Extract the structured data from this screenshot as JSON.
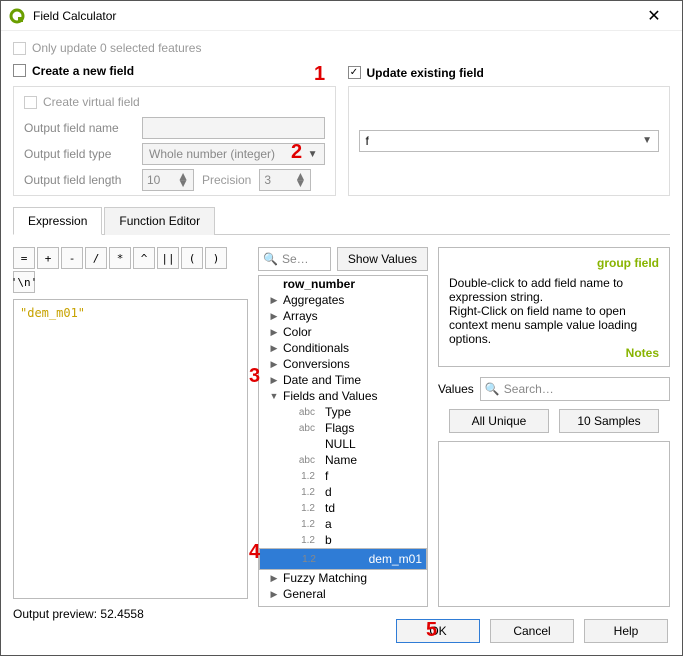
{
  "window": {
    "title": "Field Calculator"
  },
  "top": {
    "only_update_label": "Only update 0 selected features",
    "create_new_label": "Create a new field",
    "update_existing_label": "Update existing field"
  },
  "newfield": {
    "virtual_label": "Create virtual field",
    "name_label": "Output field name",
    "name_value": "",
    "type_label": "Output field type",
    "type_value": "Whole number (integer)",
    "length_label": "Output field length",
    "length_value": "10",
    "precision_label": "Precision",
    "precision_value": "3"
  },
  "updatefield": {
    "selected": "f"
  },
  "tabs": {
    "expression": "Expression",
    "function_editor": "Function Editor"
  },
  "operators": [
    "=",
    "+",
    "-",
    "/",
    "*",
    "^",
    "||",
    "(",
    ")",
    "'\\n'"
  ],
  "expression": {
    "text": "\"dem_m01\""
  },
  "preview": {
    "label": "Output preview:",
    "value": "52.4558"
  },
  "mid": {
    "search_placeholder": "Se…",
    "show_values": "Show Values",
    "tree": {
      "row_number": "row_number",
      "groups_collapsed": [
        "Aggregates",
        "Arrays",
        "Color",
        "Conditionals",
        "Conversions",
        "Date and Time"
      ],
      "expanded_group": "Fields and Values",
      "fields": [
        {
          "t": "abc",
          "n": "Type"
        },
        {
          "t": "abc",
          "n": "Flags"
        },
        {
          "t": "",
          "n": "NULL"
        },
        {
          "t": "abc",
          "n": "Name"
        },
        {
          "t": "1.2",
          "n": "f"
        },
        {
          "t": "1.2",
          "n": "d"
        },
        {
          "t": "1.2",
          "n": "td"
        },
        {
          "t": "1.2",
          "n": "a"
        },
        {
          "t": "1.2",
          "n": "b"
        },
        {
          "t": "1.2",
          "n": "dem_m01"
        }
      ],
      "groups_after": [
        "Fuzzy Matching",
        "General"
      ]
    }
  },
  "help": {
    "title": "group field",
    "body1": "Double-click to add field name to expression string.",
    "body2": "Right-Click on field name to open context menu sample value loading options.",
    "notes": "Notes"
  },
  "values": {
    "label": "Values",
    "search_placeholder": "Search…",
    "all_unique": "All Unique",
    "samples": "10 Samples"
  },
  "footer": {
    "ok": "OK",
    "cancel": "Cancel",
    "help": "Help"
  },
  "annotations": {
    "a1": "1",
    "a2": "2",
    "a3": "3",
    "a4": "4",
    "a5": "5"
  }
}
